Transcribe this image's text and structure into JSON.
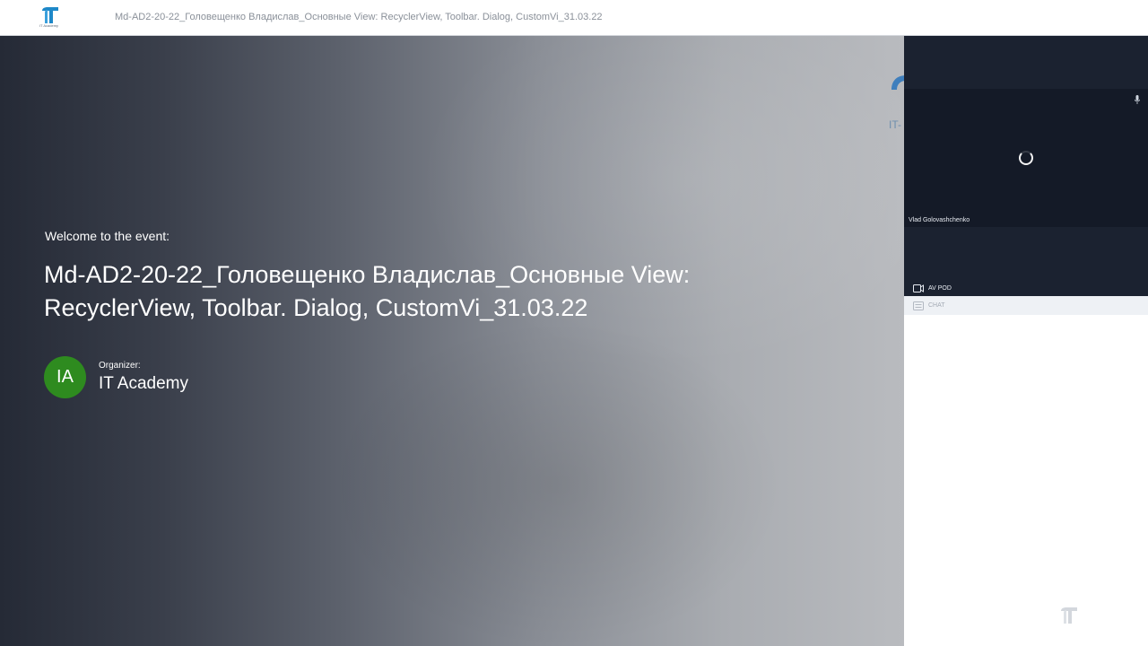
{
  "header": {
    "logo_icon": "it-academy-logo-icon",
    "logo_caption": "IT Academy",
    "title": "Md-AD2-20-22_Головещенко Владислав_Основные View: RecyclerView, Toolbar. Dialog, CustomVi_31.03.22"
  },
  "stage": {
    "welcome_text": "Welcome to the event:",
    "event_title": "Md-AD2-20-22_Головещенко Владислав_Основные View: RecyclerView, Toolbar. Dialog, CustomVi_31.03.22",
    "background_logo_text": "IT-",
    "organizer": {
      "initials": "IA",
      "label": "Organizer:",
      "name": "IT Academy",
      "avatar_color": "#2e8b1f"
    }
  },
  "right_panel": {
    "video": {
      "participant_name": "Vlad Golovashchenko",
      "loading_icon": "spinner-icon",
      "mic_icon": "microphone-icon"
    },
    "av_pod": {
      "icon": "camera-icon",
      "label": "AV POD"
    },
    "chat": {
      "icon": "chat-icon",
      "label": "CHAT"
    },
    "watermark_icon": "it-academy-logo-icon"
  },
  "colors": {
    "accent": "#1e88c8",
    "panel_dark": "#1b2230",
    "chat_tab_bg": "#eef1f5"
  }
}
